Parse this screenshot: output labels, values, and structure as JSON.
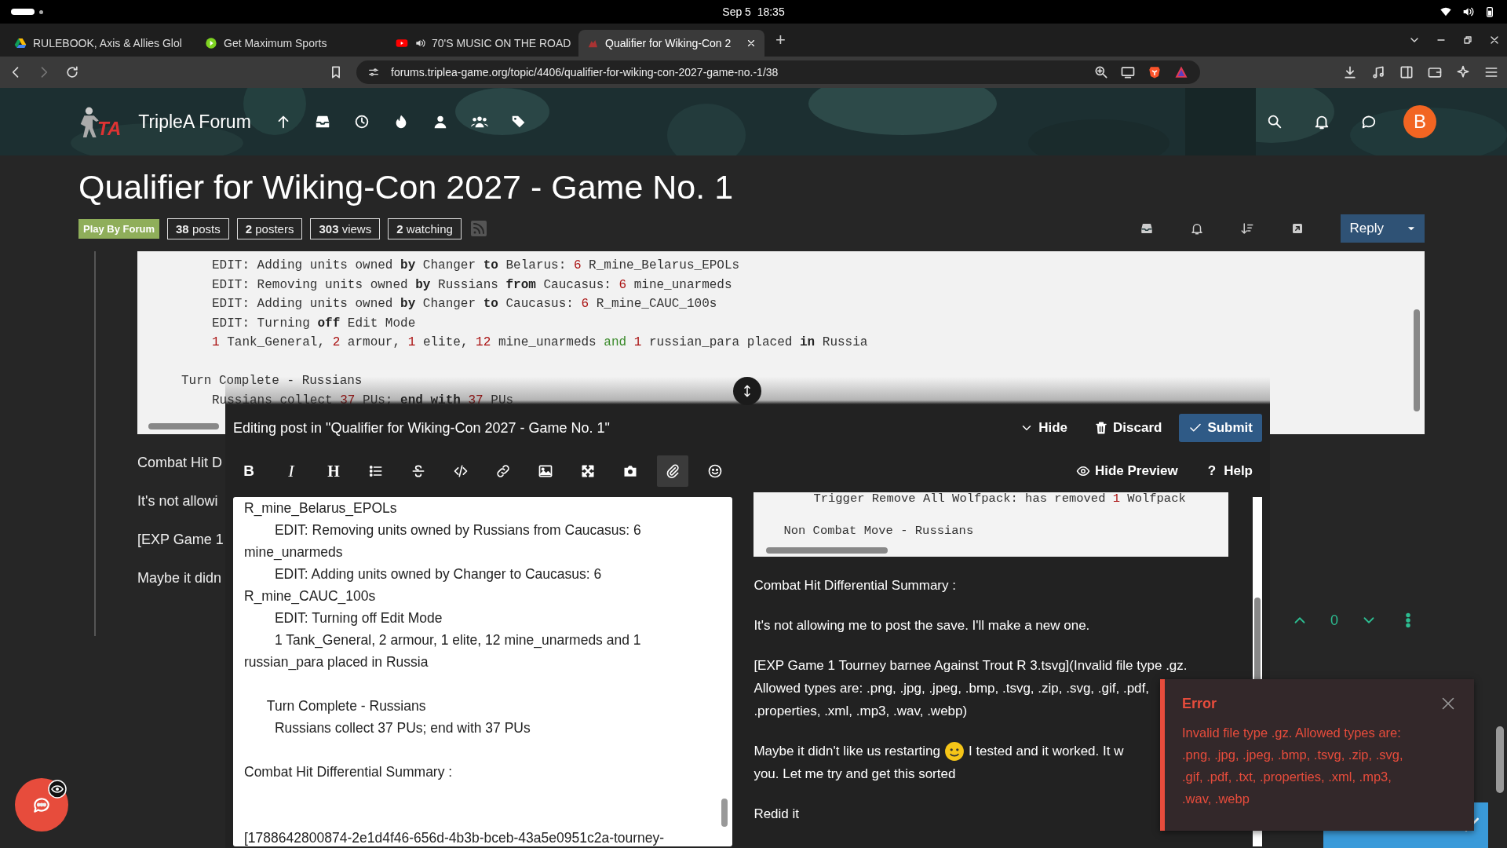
{
  "os_bar": {
    "clock": "Sep 5  18:35"
  },
  "browser": {
    "tabs": [
      {
        "title": "RULEBOOK, Axis & Allies Glol",
        "selected": false,
        "audio": false
      },
      {
        "title": "Get Maximum Sports",
        "selected": false,
        "audio": false
      },
      {
        "title": "70'S MUSIC ON THE ROAD",
        "selected": false,
        "audio": true
      },
      {
        "title": "Qualifier for Wiking-Con 2",
        "selected": true,
        "audio": false
      }
    ],
    "new_tab": "+",
    "url": "forums.triplea-game.org/topic/4406/qualifier-for-wiking-con-2027-game-no.-1/38"
  },
  "forum": {
    "logo_mark": "TA",
    "site_name": "TripleA Forum",
    "avatar": "B"
  },
  "topic": {
    "title": "Qualifier for Wiking-Con 2027 - Game No. 1",
    "tag": "Play By Forum",
    "stats": [
      "**38** posts",
      "**2** posters",
      "**303** views",
      "**2** watching"
    ],
    "reply": "Reply"
  },
  "post": {
    "code_lines": [
      {
        "kind": "inner",
        "parts": [
          {
            "text": "EDIT: Adding units owned ",
            "kind": "plain"
          },
          {
            "text": "by",
            "kind": "keyword"
          },
          {
            "text": " Changer ",
            "kind": "plain"
          },
          {
            "text": "to",
            "kind": "keyword"
          },
          {
            "text": " Belarus: ",
            "kind": "plain"
          },
          {
            "text": "6",
            "kind": "number"
          },
          {
            "text": " R_mine_Belarus_EPOLs",
            "kind": "plain"
          }
        ]
      },
      {
        "kind": "inner",
        "parts": [
          {
            "text": "EDIT: Removing units owned ",
            "kind": "plain"
          },
          {
            "text": "by",
            "kind": "keyword"
          },
          {
            "text": " Russians ",
            "kind": "plain"
          },
          {
            "text": "from",
            "kind": "keyword"
          },
          {
            "text": " Caucasus: ",
            "kind": "plain"
          },
          {
            "text": "6",
            "kind": "number"
          },
          {
            "text": " mine_unarmeds",
            "kind": "plain"
          }
        ]
      },
      {
        "kind": "inner",
        "parts": [
          {
            "text": "EDIT: Adding units owned ",
            "kind": "plain"
          },
          {
            "text": "by",
            "kind": "keyword"
          },
          {
            "text": " Changer ",
            "kind": "plain"
          },
          {
            "text": "to",
            "kind": "keyword"
          },
          {
            "text": " Caucasus: ",
            "kind": "plain"
          },
          {
            "text": "6",
            "kind": "number"
          },
          {
            "text": " R_mine_CAUC_100s",
            "kind": "plain"
          }
        ]
      },
      {
        "kind": "inner",
        "parts": [
          {
            "text": "EDIT: Turning ",
            "kind": "plain"
          },
          {
            "text": "off",
            "kind": "keyword"
          },
          {
            "text": " Edit Mode",
            "kind": "plain"
          }
        ]
      },
      {
        "kind": "inner",
        "parts": [
          {
            "text": "1",
            "kind": "number"
          },
          {
            "text": " Tank_General, ",
            "kind": "plain"
          },
          {
            "text": "2",
            "kind": "number"
          },
          {
            "text": " armour, ",
            "kind": "plain"
          },
          {
            "text": "1",
            "kind": "number"
          },
          {
            "text": " elite, ",
            "kind": "plain"
          },
          {
            "text": "12",
            "kind": "number"
          },
          {
            "text": " mine_unarmeds ",
            "kind": "plain"
          },
          {
            "text": "and ",
            "kind": "literal"
          },
          {
            "text": "1",
            "kind": "number"
          },
          {
            "text": " russian_para placed ",
            "kind": "plain"
          },
          {
            "text": "in",
            "kind": "keyword"
          },
          {
            "text": " Russia",
            "kind": "plain"
          }
        ]
      },
      {
        "kind": "outer",
        "parts": [
          {
            "text": "Turn Complete - Russians",
            "kind": "plain"
          }
        ]
      },
      {
        "kind": "inner",
        "parts": [
          {
            "text": "Russians collect ",
            "kind": "plain"
          },
          {
            "text": "37",
            "kind": "number"
          },
          {
            "text": " PUs; ",
            "kind": "plain"
          },
          {
            "text": "end with ",
            "kind": "keyword"
          },
          {
            "text": "37",
            "kind": "number"
          },
          {
            "text": " PUs",
            "kind": "plain"
          }
        ]
      }
    ],
    "paragraphs": [
      "Combat Hit D",
      "It's not allowi",
      "[EXP Game 1",
      "Maybe it didn"
    ],
    "votes": "0"
  },
  "composer": {
    "title": "Editing post in \"Qualifier for Wiking-Con 2027 - Game No. 1\"",
    "hide": "Hide",
    "discard": "Discard",
    "submit": "Submit",
    "toolbar": [
      {
        "label": "B",
        "selected": false
      },
      {
        "label": "I",
        "selected": false
      },
      {
        "label": "H",
        "selected": false
      },
      {
        "selected": false
      },
      {
        "selected": false
      },
      {
        "selected": false
      },
      {
        "selected": false
      },
      {
        "selected": false
      },
      {
        "selected": false
      },
      {
        "selected": false
      },
      {
        "selected": true
      },
      {
        "selected": false
      }
    ],
    "hide_preview": "Hide Preview",
    "help_mark": "?",
    "help": "Help",
    "editor_text": "R_mine_Belarus_EPOLs\n        EDIT: Removing units owned by Russians from Caucasus: 6\nmine_unarmeds\n        EDIT: Adding units owned by Changer to Caucasus: 6\nR_mine_CAUC_100s\n        EDIT: Turning off Edit Mode\n        1 Tank_General, 2 armour, 1 elite, 12 mine_unarmeds and 1\nrussian_para placed in Russia\n\n      Turn Complete - Russians\n        Russians collect 37 PUs; end with 37 PUs\n\nCombat Hit Differential Summary :\n\n\n[1788642800874-2e1d4f46-656d-4b3b-bceb-43a5e0951c2a-tourney-",
    "preview": {
      "code_lines": [
        {
          "kind": "inner",
          "parts": [
            {
              "text": "Trigger Remove All Wolfpack: has removed ",
              "kind": "plain"
            },
            {
              "text": "1",
              "kind": "number"
            },
            {
              "text": " Wolfpack",
              "kind": "plain"
            }
          ]
        },
        {
          "kind": "outer",
          "parts": [
            {
              "text": "Non Combat Move - Russians",
              "kind": "plain"
            }
          ]
        }
      ],
      "paragraphs": [
        [
          [
            {
              "text": "Combat Hit Differential Summary :",
              "kind": "text"
            }
          ]
        ],
        [
          [
            {
              "text": "It's not allowing me to post the save. I'll make a new one.",
              "kind": "text"
            }
          ]
        ],
        [
          [
            {
              "text": "[EXP Game 1 Tourney barnee Against Trout R 3.tsvg](Invalid file type .gz.",
              "kind": "text"
            }
          ],
          [
            {
              "text": "Allowed types are: .png, .jpg, .jpeg, .bmp, .tsvg, .zip, .svg, .gif, .pdf,",
              "kind": "text"
            }
          ],
          [
            {
              "text": ".properties, .xml, .mp3, .wav, .webp)",
              "kind": "text"
            }
          ]
        ],
        [
          [
            {
              "text": "Maybe it didn't like us restarting",
              "kind": "text"
            },
            {
              "kind": "emoji"
            },
            {
              "text": "I tested and it worked. It w",
              "kind": "text"
            }
          ],
          [
            {
              "text": "you. Let me try and get this sorted",
              "kind": "text"
            }
          ]
        ],
        [
          [
            {
              "text": "Redid it",
              "kind": "text"
            }
          ]
        ]
      ]
    }
  },
  "toast": {
    "title": "Error",
    "message": "Invalid file type .gz. Allowed types are: .png, .jpg, .jpeg, .bmp, .tsvg, .zip, .svg, .gif, .pdf, .txt, .properties, .xml, .mp3, .wav, .webp"
  }
}
